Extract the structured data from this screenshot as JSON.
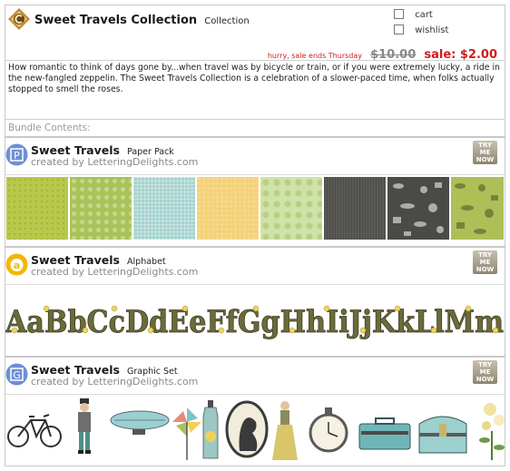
{
  "header": {
    "title": "Sweet Travels Collection",
    "subtitle": "Collection",
    "cart_label": "cart",
    "wishlist_label": "wishlist",
    "hurry_text": "hurry, sale ends Thursday",
    "old_price": "$10.00",
    "sale_price": "sale: $2.00"
  },
  "description": "How romantic to think of days gone by...when travel was by bicycle or train, or if you were extremely lucky, a ride in the new-fangled zeppelin. The Sweet Travels Collection is a celebration of a slower-paced time, when folks actually stopped to smell the roses.",
  "bundle_label": "Bundle Contents:",
  "try_button": [
    "TRY",
    "ME",
    "NOW"
  ],
  "products": [
    {
      "name": "Sweet Travels",
      "type": "Paper Pack",
      "creator": "created by LetteringDelights.com",
      "icon_letter": "P",
      "icon_color": "#6d8fd6"
    },
    {
      "name": "Sweet Travels",
      "type": "Alphabet",
      "creator": "created by LetteringDelights.com",
      "icon_letter": "a",
      "icon_color": "#f2b705",
      "sample": "AaBbCcDdEeFfGgHhIiJjKkLlMm"
    },
    {
      "name": "Sweet Travels",
      "type": "Graphic Set",
      "creator": "created by LetteringDelights.com",
      "icon_letter": "G",
      "icon_color": "#6d8fd6"
    }
  ],
  "colors": {
    "accent_red": "#d21a1a",
    "muted_gray": "#8a8a8a",
    "paper_swatches": [
      "#b8c84a",
      "#a9c25a",
      "#a6d3cf",
      "#f4d27a",
      "#cfe2a8",
      "#5a5a55",
      "#4a4a48",
      "#aebf58"
    ]
  },
  "icons": {
    "logo": "ornate-c-logo-icon",
    "paper_pack": "paper-pack-icon",
    "alphabet": "alphabet-icon",
    "graphic_set": "graphic-set-icon"
  },
  "graphics": [
    "bicycle",
    "gentleman",
    "zeppelin",
    "pinwheel",
    "bottle",
    "cameo",
    "lady",
    "pocket-watch",
    "suitcase",
    "trunk",
    "roses"
  ]
}
